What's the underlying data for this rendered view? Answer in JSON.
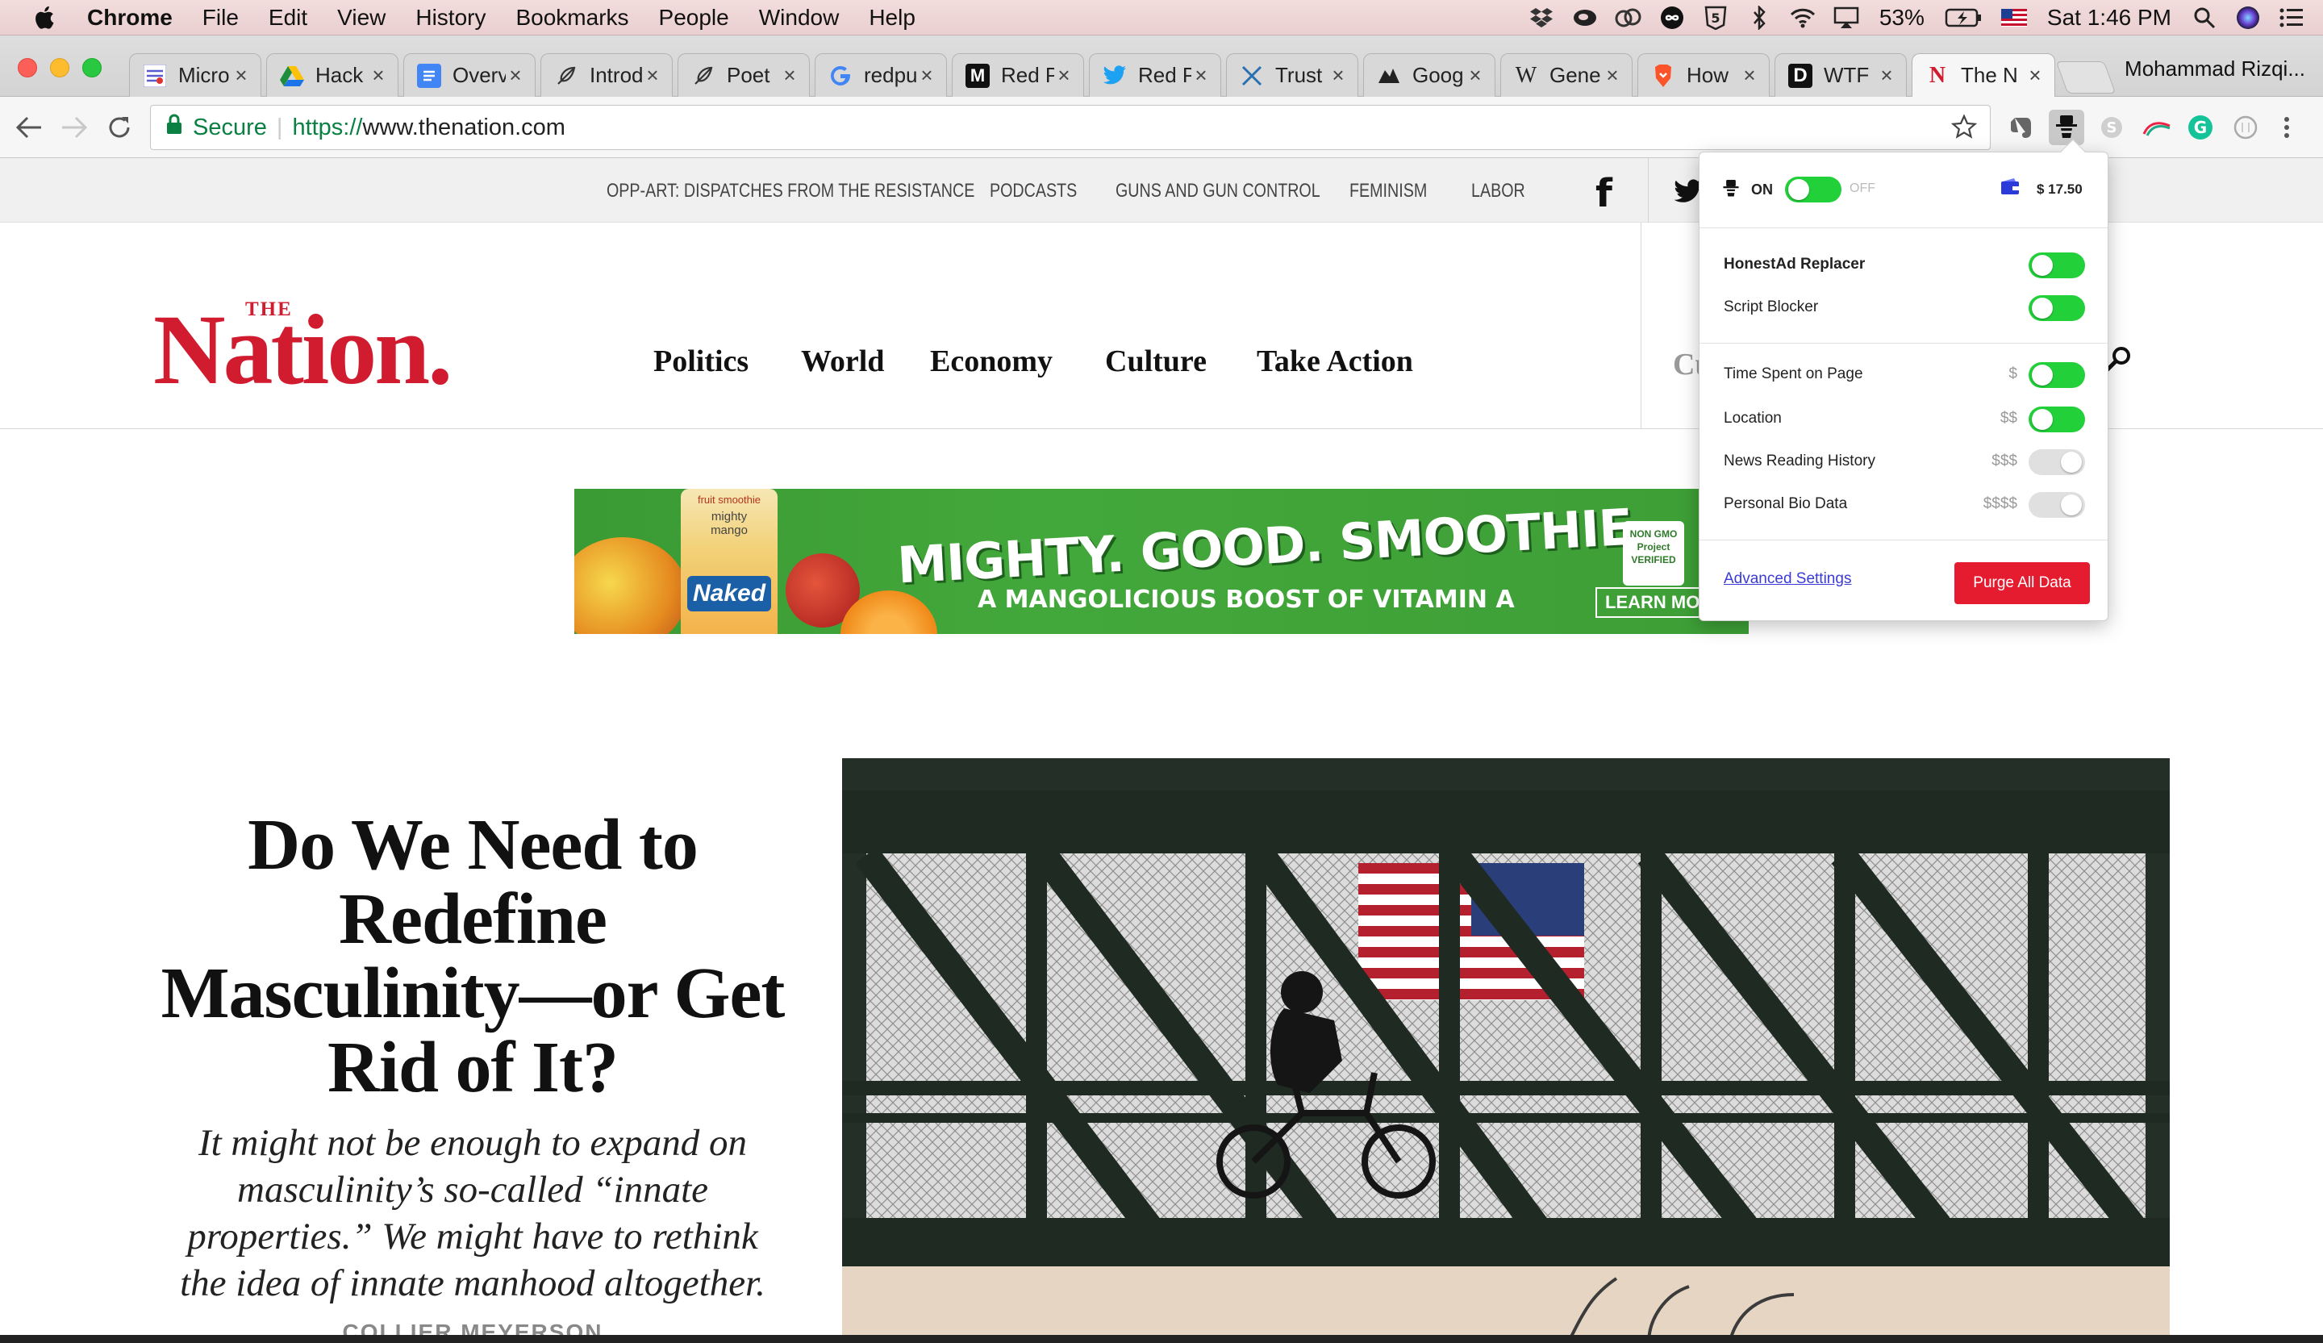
{
  "menubar": {
    "app_name": "Chrome",
    "menus": [
      "File",
      "Edit",
      "View",
      "History",
      "Bookmarks",
      "People",
      "Window",
      "Help"
    ],
    "battery": "53%",
    "clock": "Sat 1:46 PM"
  },
  "tabs": [
    {
      "title": "Micro",
      "icon": "microsoft-icon"
    },
    {
      "title": "Hack",
      "icon": "google-drive-icon"
    },
    {
      "title": "Overv",
      "icon": "google-docs-icon"
    },
    {
      "title": "Introd",
      "icon": "quill-icon"
    },
    {
      "title": "Poet",
      "icon": "quill-icon"
    },
    {
      "title": "redpu",
      "icon": "google-icon"
    },
    {
      "title": "Red P",
      "icon": "medium-icon"
    },
    {
      "title": "Red P",
      "icon": "twitter-icon"
    },
    {
      "title": "Trust",
      "icon": "x-logo-icon"
    },
    {
      "title": "Goog",
      "icon": "bird-icon"
    },
    {
      "title": "Gene",
      "icon": "wikipedia-icon"
    },
    {
      "title": "How",
      "icon": "brave-icon"
    },
    {
      "title": "WTF",
      "icon": "d-logo-icon"
    },
    {
      "title": "The N",
      "icon": "nation-icon",
      "active": true
    }
  ],
  "profile_name": "Mohammad Rizqi...",
  "omnibox": {
    "secure_label": "Secure",
    "url_scheme": "https://",
    "url_host": "www.thenation.com"
  },
  "site": {
    "topnav": [
      "OPP-ART: DISPATCHES FROM THE RESISTANCE",
      "PODCASTS",
      "GUNS AND GUN CONTROL",
      "FEMINISM",
      "LABOR"
    ],
    "logo_the": "THE",
    "logo_name": "Nation.",
    "mainnav": [
      "Politics",
      "World",
      "Economy",
      "Culture",
      "Take Action"
    ],
    "search_partial": "Cu",
    "ad": {
      "headline": "MIGHTY. GOOD. SMOOTHIE.",
      "subline": "A MANGOLICIOUS BOOST OF VITAMIN A",
      "brand": "Naked",
      "bottle_tag": "fruit smoothie",
      "bottle_name": "mighty mango",
      "badge": "NON GMO Project VERIFIED",
      "cta": "LEARN MORE"
    },
    "article": {
      "headline": "Do We Need to Redefine Masculinity—or Get Rid of It?",
      "dek": "It might not be enough to expand on masculinity’s so-called “innate properties.” We might have to rethink the idea of innate manhood altogether.",
      "byline": "COLLIER MEYERSON"
    }
  },
  "popup": {
    "on_label": "ON",
    "off_label": "OFF",
    "balance": "$ 17.50",
    "rows_group1": [
      {
        "label": "HonestAd Replacer",
        "bold": true,
        "on": true
      },
      {
        "label": "Script Blocker",
        "bold": false,
        "on": true
      }
    ],
    "rows_group2": [
      {
        "label": "Time Spent on Page",
        "price": "$",
        "on": true
      },
      {
        "label": "Location",
        "price": "$$",
        "on": true
      },
      {
        "label": "News Reading History",
        "price": "$$$",
        "on": false
      },
      {
        "label": "Personal Bio Data",
        "price": "$$$$",
        "on": false
      }
    ],
    "advanced_link": "Advanced Settings",
    "purge_button": "Purge All Data"
  },
  "colors": {
    "nation_red": "#d11b2f",
    "toggle_green": "#22d13a",
    "purge_red": "#e51b2f",
    "link_blue": "#3b3bd6",
    "secure_green": "#0b8043"
  }
}
